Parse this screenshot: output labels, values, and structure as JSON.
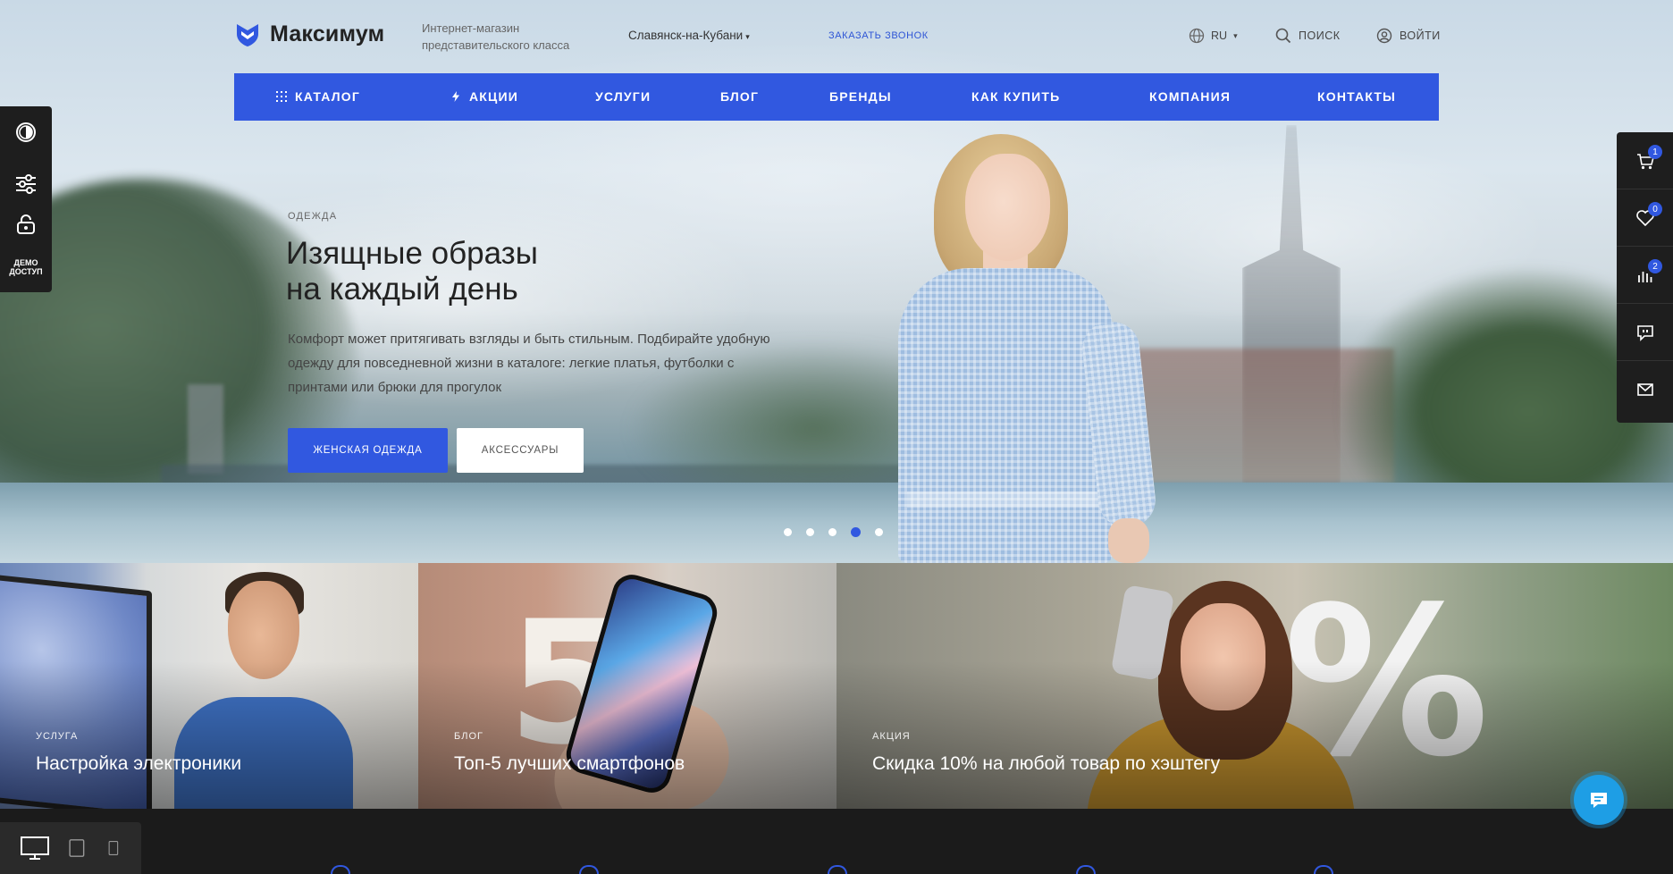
{
  "header": {
    "logo_text": "Максимум",
    "tagline": "Интернет-магазин представительского класса",
    "city": "Славянск-на-Кубани",
    "callback": "ЗАКАЗАТЬ ЗВОНОК",
    "lang": "RU",
    "search": "поиск",
    "login": "войти"
  },
  "nav": {
    "items": [
      {
        "label": "КАТАЛОГ",
        "icon": "grid-icon"
      },
      {
        "label": "АКЦИИ",
        "icon": "lightning-icon"
      },
      {
        "label": "УСЛУГИ"
      },
      {
        "label": "БЛОГ"
      },
      {
        "label": "БРЕНДЫ"
      },
      {
        "label": "КАК КУПИТЬ"
      },
      {
        "label": "КОМПАНИЯ"
      },
      {
        "label": "КОНТАКТЫ"
      }
    ]
  },
  "slide": {
    "category": "ОДЕЖДА",
    "title_line1": "Изящные образы",
    "title_line2": "на каждый день",
    "text": "Комфорт может притягивать взгляды и быть стильным. Подбирайте удобную одежду для повседневной жизни в каталоге: легкие платья, футболки с принтами или брюки для прогулок",
    "btn_primary": "ЖЕНСКАЯ ОДЕЖДА",
    "btn_secondary": "АКСЕССУАРЫ",
    "dots_total": 5,
    "active_dot": 4
  },
  "left_panel": {
    "demo_line1": "ДЕМО",
    "demo_line2": "ДОСТУП"
  },
  "right_panel": {
    "cart_count": "1",
    "favorites_count": "0",
    "compare_count": "2"
  },
  "banners": [
    {
      "category": "УСЛУГА",
      "title": "Настройка электроники"
    },
    {
      "category": "БЛОГ",
      "title": "Топ-5 лучших смартфонов"
    },
    {
      "category": "АКЦИЯ",
      "title": "Скидка 10% на любой товар по хэштегу"
    }
  ],
  "colors": {
    "accent": "#3158e0",
    "chat": "#1e9ee5",
    "panel": "#1e1e1e"
  }
}
